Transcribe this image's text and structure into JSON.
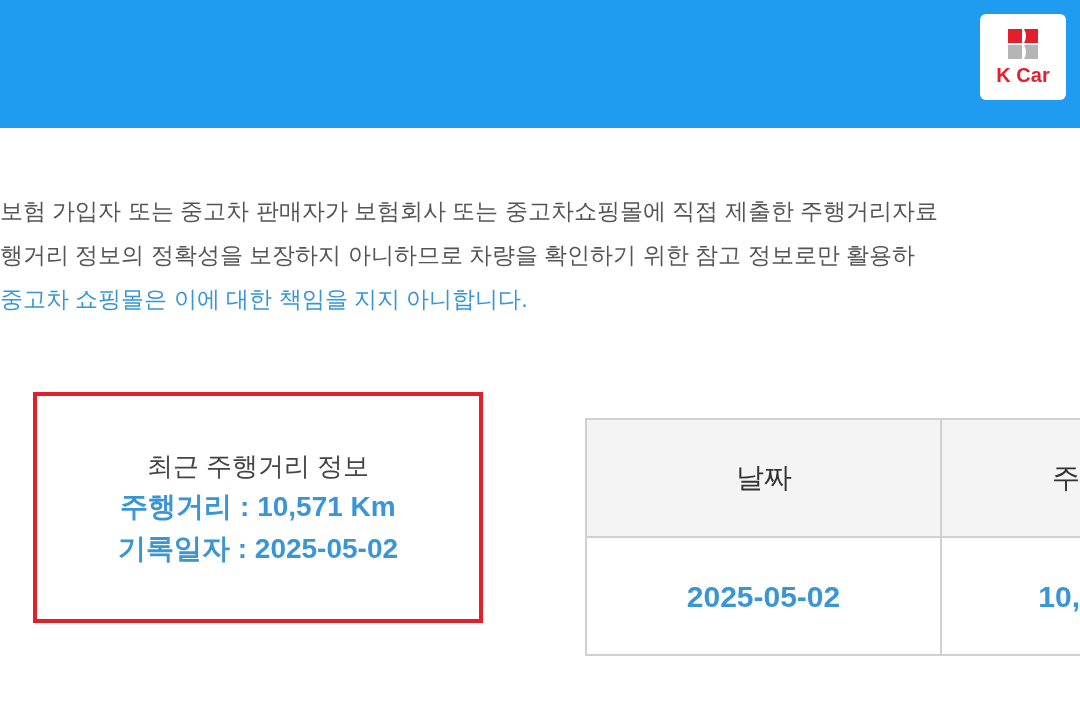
{
  "header": {
    "logo_text": "K Car"
  },
  "notice": [
    {
      "kind": "normal",
      "text": "보험 가입자 또는 중고차 판매자가 보험회사 또는 중고차쇼핑몰에 직접 제출한 주행거리자료"
    },
    {
      "kind": "normal",
      "text": "행거리 정보의 정확성을 보장하지 아니하므로 차량을 확인하기 위한 참고 정보로만 활용하"
    },
    {
      "kind": "highlight",
      "text": "중고차 쇼핑몰은 이에 대한 책임을 지지 아니합니다."
    }
  ],
  "recent_mileage": {
    "title": "최근 주행거리 정보",
    "mileage": "주행거리 : 10,571 Km",
    "date": "기록일자 : 2025-05-02"
  },
  "table": {
    "columns": [
      "날짜",
      "주"
    ],
    "rows": [
      [
        "2025-05-02",
        "10,"
      ]
    ]
  }
}
